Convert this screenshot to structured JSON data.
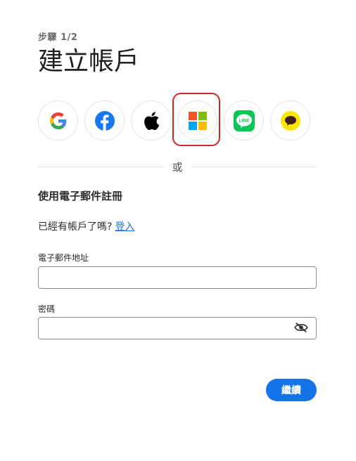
{
  "header": {
    "step": "步驟  1/2",
    "title": "建立帳戶"
  },
  "social_providers": [
    {
      "name": "google-icon"
    },
    {
      "name": "facebook-icon"
    },
    {
      "name": "apple-icon"
    },
    {
      "name": "microsoft-icon",
      "highlighted": true
    },
    {
      "name": "line-icon",
      "text": "LINE"
    },
    {
      "name": "kakaotalk-icon"
    }
  ],
  "divider": {
    "text": "或"
  },
  "email_section": {
    "heading": "使用電子郵件註冊",
    "have_account_text": "已經有帳戶了嗎?",
    "sign_in_link": "登入"
  },
  "form": {
    "email_label": "電子郵件地址",
    "email_value": "",
    "password_label": "密碼",
    "password_value": ""
  },
  "actions": {
    "continue_label": "繼續"
  },
  "colors": {
    "accent": "#1473e6",
    "highlight_border": "#d62424",
    "facebook": "#1877f2",
    "line": "#06c755",
    "kakao": "#fee500"
  }
}
